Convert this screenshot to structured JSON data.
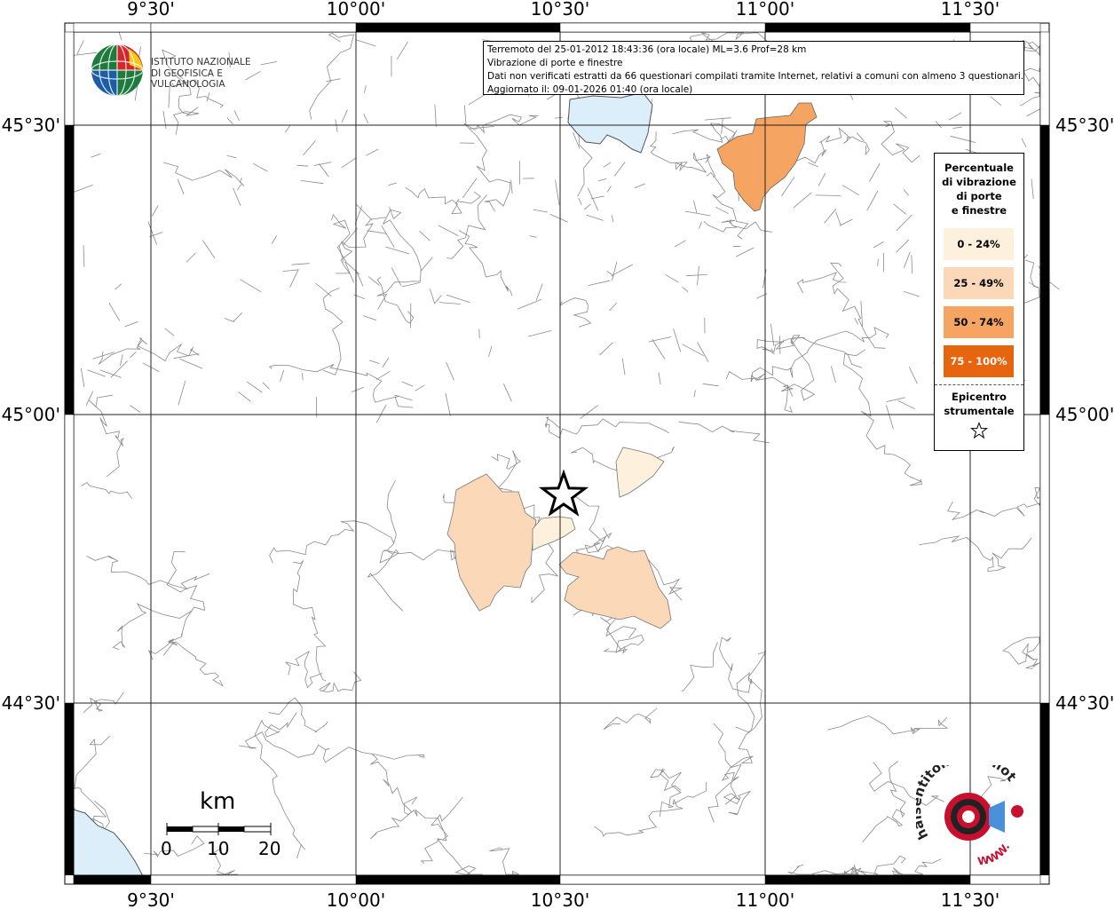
{
  "map": {
    "top_axis_labels": [
      "9°30'",
      "10°00'",
      "10°30'",
      "11°00'",
      "11°30'"
    ],
    "bottom_axis_labels": [
      "9°30'",
      "10°00'",
      "10°30'",
      "11°00'",
      "11°30'"
    ],
    "left_axis_labels": [
      "45°30'",
      "45°00'",
      "44°30'"
    ],
    "right_axis_labels": [
      "45°30'",
      "45°00'",
      "44°30'"
    ],
    "water_color": "#dceefa",
    "boundary_color": "#8a8a8a"
  },
  "info": {
    "line1": "Terremoto del 25-01-2012 18:43:36 (ora locale) ML=3.6 Prof=28 km",
    "line2": "Vibrazione di porte e finestre",
    "line3": "Dati non verificati estratti da 66 questionari compilati tramite Internet, relativi a comuni con almeno 3 questionari.",
    "line4": "Aggiornato il: 09-01-2026 01:40 (ora locale)"
  },
  "logo": {
    "line1": "Istituto Nazionale",
    "line2": "di Geofisica e Vulcanologia",
    "icon": "globe-icon"
  },
  "legend": {
    "title": "Percentuale\ndi vibrazione\ndi porte\ne finestre",
    "items": [
      {
        "label": "0 - 24%",
        "color": "#fdf0dc"
      },
      {
        "label": "25 - 49%",
        "color": "#fbd9b8"
      },
      {
        "label": "50 - 74%",
        "color": "#f6a462"
      },
      {
        "label": "75 - 100%",
        "color": "#e8650f"
      }
    ],
    "epicenter_label": "Epicentro\nstrumentale",
    "epicenter_icon": "star-icon"
  },
  "scalebar": {
    "unit": "km",
    "labels": [
      "0",
      "10",
      "20"
    ]
  },
  "site_logo": {
    "text": "haisentitoilterremoto.it",
    "url_text": "WWW."
  }
}
